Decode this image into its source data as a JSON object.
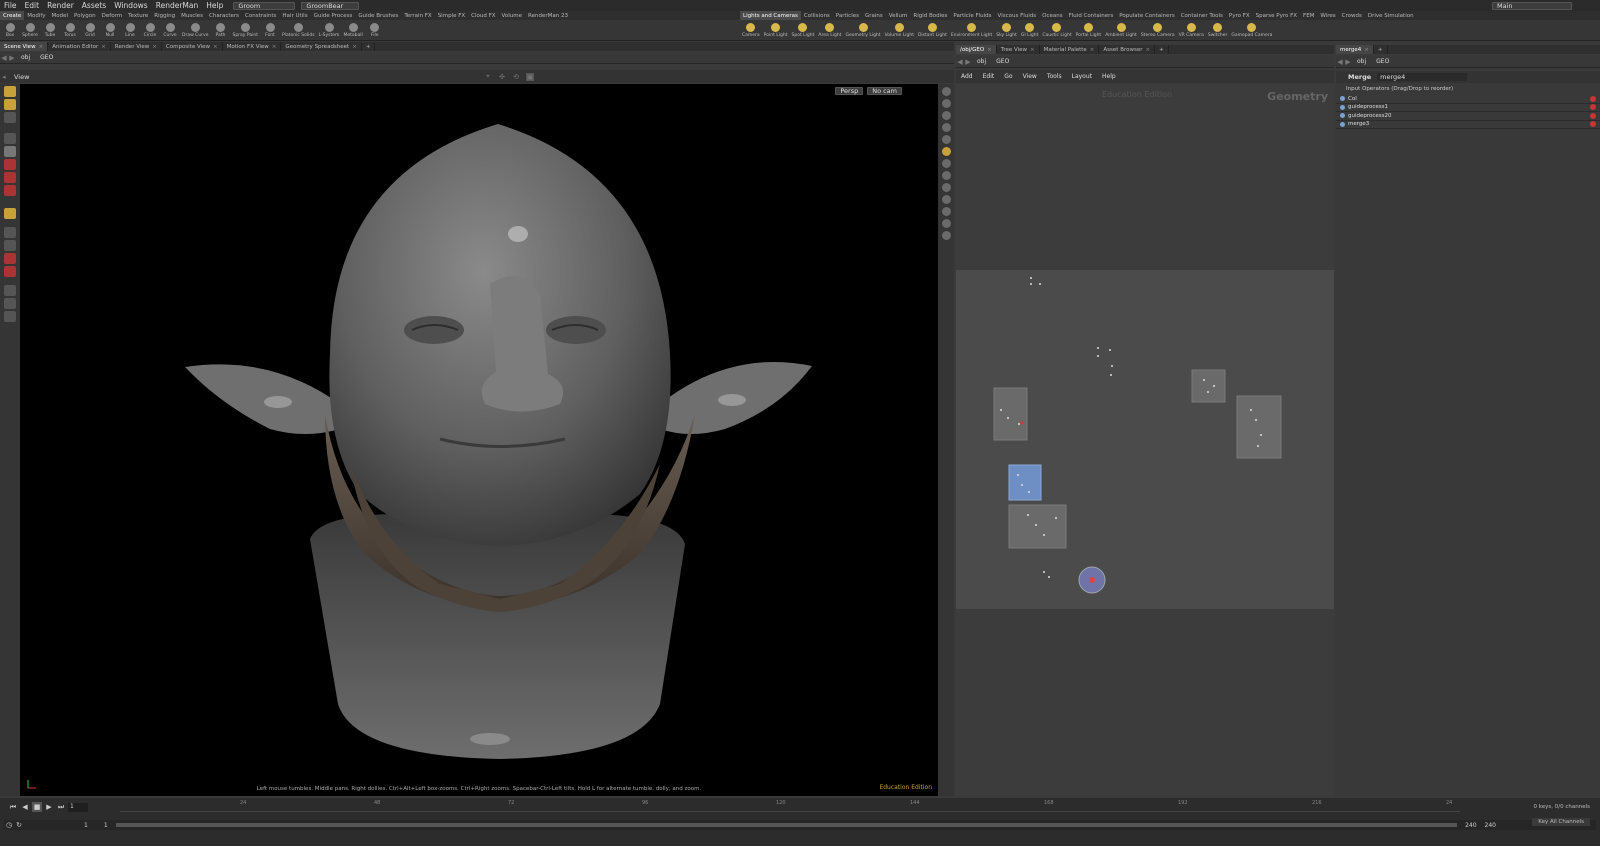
{
  "menubar": {
    "items": [
      "File",
      "Edit",
      "Render",
      "Assets",
      "Windows",
      "RenderMan",
      "Help"
    ],
    "desktop": "Groom",
    "scene": "GroomBear",
    "workspace": "Main"
  },
  "shelf_tabs_left": [
    "Create",
    "Modify",
    "Model",
    "Polygon",
    "Deform",
    "Texture",
    "Rigging",
    "Muscles",
    "Characters",
    "Constraints",
    "Hair Utils",
    "Guide Process",
    "Guide Brushes",
    "Terrain FX",
    "Simple FX",
    "Cloud FX",
    "Volume",
    "RenderMan 23"
  ],
  "shelf_tabs_right": [
    "Lights and Cameras",
    "Collisions",
    "Particles",
    "Grains",
    "Vellum",
    "Rigid Bodies",
    "Particle Fluids",
    "Viscous Fluids",
    "Oceans",
    "Fluid Containers",
    "Populate Containers",
    "Container Tools",
    "Pyro FX",
    "Sparse Pyro FX",
    "FEM",
    "Wires",
    "Crowds",
    "Drive Simulation"
  ],
  "shelf_tools_left": [
    "Box",
    "Sphere",
    "Tube",
    "Torus",
    "Grid",
    "Null",
    "Line",
    "Circle",
    "Curve",
    "Draw Curve",
    "Path",
    "Spray Paint",
    "Font",
    "Platonic Solids",
    "L-System",
    "Metaball",
    "File"
  ],
  "shelf_tools_right": [
    "Camera",
    "Point Light",
    "Spot Light",
    "Area Light",
    "Geometry Light",
    "Volume Light",
    "Distant Light",
    "Environment Light",
    "Sky Light",
    "GI Light",
    "Caustic Light",
    "Portal Light",
    "Ambient Light",
    "Stereo Camera",
    "VR Camera",
    "Switcher",
    "Gamepad Camera"
  ],
  "left_pane_tabs": [
    "Scene View",
    "Animation Editor",
    "Render View",
    "Composite View",
    "Motion FX View",
    "Geometry Spreadsheet"
  ],
  "left_path": [
    "obj",
    "GEO"
  ],
  "viewport": {
    "title": "View",
    "persp": "Persp",
    "cam": "No cam",
    "hint": "Left mouse tumbles. Middle pans. Right dollies. Ctrl+Alt+Left box-zooms. Ctrl+Right zooms. Spacebar-Ctrl-Left tilts. Hold L for alternate tumble, dolly, and zoom.",
    "edition": "Education Edition"
  },
  "mid_pane_tabs": [
    "/obj/GEO",
    "Tree View",
    "Material Palette",
    "Asset Browser"
  ],
  "mid_path": [
    "obj",
    "GEO"
  ],
  "network_menu": [
    "Add",
    "Edit",
    "Go",
    "View",
    "Tools",
    "Layout",
    "Help"
  ],
  "network": {
    "edition": "Education Edition",
    "context": "Geometry"
  },
  "right_pane_tabs": [
    "merge4"
  ],
  "right_path": [
    "obj",
    "GEO"
  ],
  "params": {
    "op_type": "Merge",
    "op_name": "merge4",
    "section": "Input Operators (Drag/Drop to reorder)",
    "inputs": [
      "Col",
      "guideprocess1",
      "guideprocess20",
      "merge3"
    ]
  },
  "timeline": {
    "ticks": [
      "24",
      "48",
      "72",
      "96",
      "120",
      "144",
      "168",
      "192",
      "216",
      "24"
    ],
    "frame": "1",
    "start": "1",
    "start2": "1",
    "end": "240",
    "end2": "240",
    "keys": "0 keys, 0/0 channels",
    "key_all": "Key All Channels"
  }
}
